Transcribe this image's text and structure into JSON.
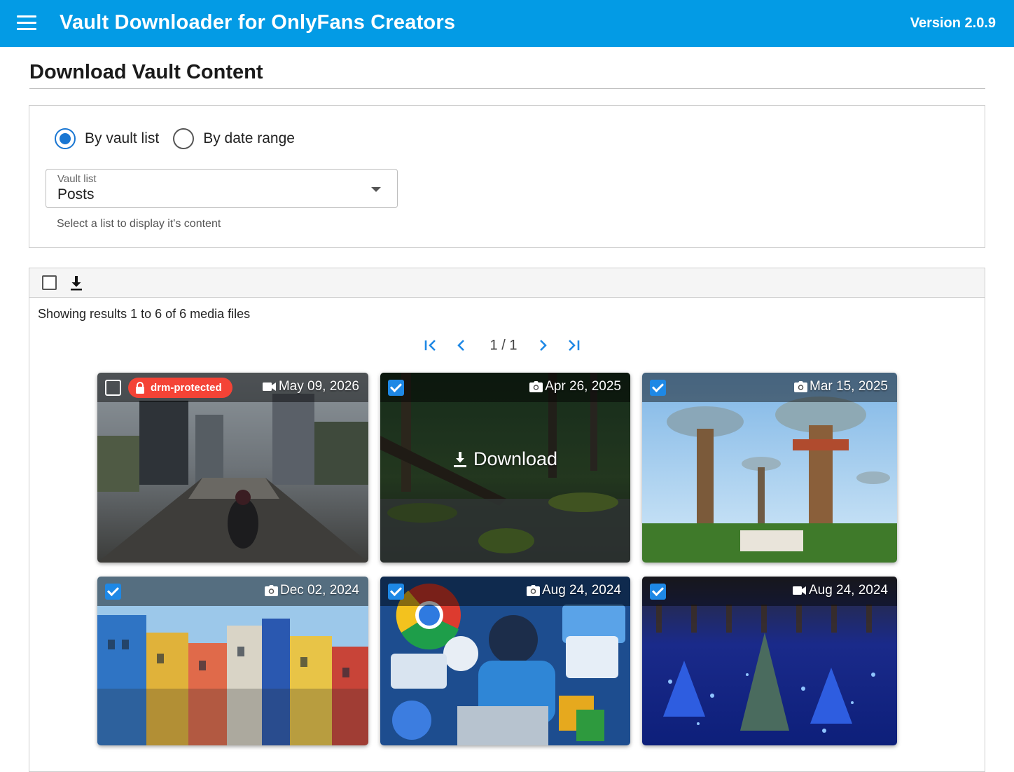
{
  "appbar": {
    "title": "Vault Downloader for OnlyFans Creators",
    "version": "Version 2.0.9"
  },
  "page": {
    "title": "Download Vault Content"
  },
  "mode": {
    "options": [
      {
        "label": "By vault list",
        "selected": true
      },
      {
        "label": "By date range",
        "selected": false
      }
    ]
  },
  "vault_select": {
    "label": "Vault list",
    "value": "Posts",
    "help": "Select a list to display it's content"
  },
  "results": {
    "summary": "Showing results 1 to 6 of 6 media files"
  },
  "pager": {
    "text": "1 / 1"
  },
  "colors": {
    "appbar": "#039be5",
    "accent": "#1976d2",
    "checkbox": "#1e88e5",
    "drm": "#f44336"
  },
  "media": [
    {
      "date": "May 09, 2026",
      "type": "video",
      "checked": false,
      "badge": "drm-protected"
    },
    {
      "date": "Apr 26, 2025",
      "type": "photo",
      "checked": true,
      "hover_label": "Download"
    },
    {
      "date": "Mar 15, 2025",
      "type": "photo",
      "checked": true
    },
    {
      "date": "Dec 02, 2024",
      "type": "photo",
      "checked": true
    },
    {
      "date": "Aug 24, 2024",
      "type": "photo",
      "checked": true
    },
    {
      "date": "Aug 24, 2024",
      "type": "video",
      "checked": true
    }
  ]
}
